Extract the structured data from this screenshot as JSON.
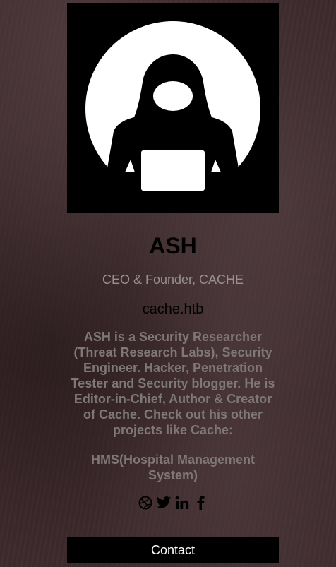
{
  "profile": {
    "name": "ASH",
    "title": "CEO & Founder, CACHE",
    "site": "cache.htb",
    "bio": "ASH is a Security Researcher (Threat Research Labs), Security Engineer. Hacker, Penetration Tester and Security blogger. He is Editor-in-Chief, Author & Creator of Cache. Check out his other projects like Cache:",
    "projects": "HMS(Hospital Management System)"
  },
  "social": {
    "icons": [
      "dribbble-icon",
      "twitter-icon",
      "linkedin-icon",
      "facebook-icon"
    ]
  },
  "contact": {
    "label": "Contact"
  },
  "colors": {
    "background": "#3d2a2c",
    "title_text": "#9a8f90",
    "body_text": "#7f7778",
    "button_bg": "#000000",
    "button_text": "#ffffff"
  }
}
